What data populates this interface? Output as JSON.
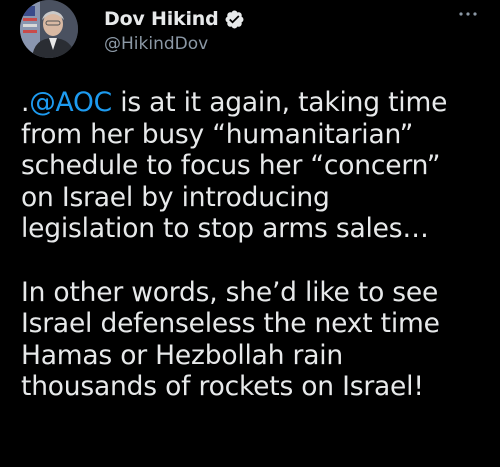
{
  "author": {
    "display_name": "Dov Hikind",
    "handle": "@HikindDov",
    "verified": true,
    "avatar_icon": "profile-photo-icon"
  },
  "menu": {
    "more_icon": "more-options-icon"
  },
  "tweet": {
    "paragraph1": {
      "prefix": ".",
      "mention": "@AOC",
      "lines": [
        " is at it again, taking time",
        "from her busy “humanitarian”",
        "schedule to focus her “concern”",
        "on Israel by introducing",
        "legislation to stop arms sales…"
      ]
    },
    "paragraph2": {
      "lines": [
        "In other words, she’d like to see",
        "Israel defenseless the next time",
        "Hamas or Hezbollah rain",
        "thousands of rockets on Israel!"
      ]
    }
  },
  "colors": {
    "background": "#000000",
    "text": "#e7e9ea",
    "secondary_text": "#8b98a5",
    "link": "#1d9bf0",
    "verified_badge": "#1d9bf0"
  }
}
